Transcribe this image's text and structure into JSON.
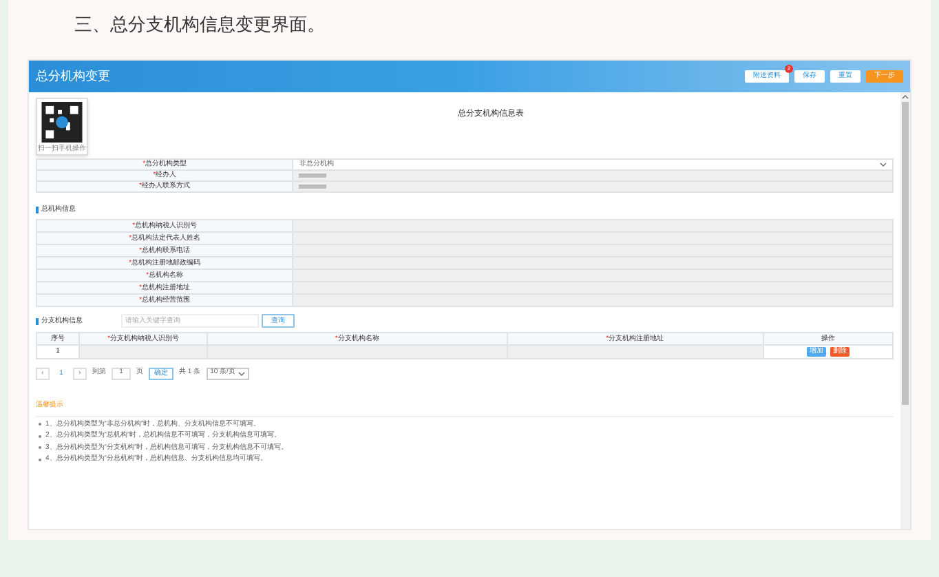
{
  "doc_heading": "三、总分支机构信息变更界面。",
  "window": {
    "title": "总分机构变更",
    "buttons": [
      {
        "label": "附送资料",
        "badge": "2",
        "kind": "plain"
      },
      {
        "label": "保存",
        "kind": "plain"
      },
      {
        "label": "重置",
        "kind": "plain"
      },
      {
        "label": "下一步",
        "kind": "primary"
      }
    ]
  },
  "qr_caption": "扫一扫手机操作",
  "required_mark": "*",
  "form_title": "总分支机构信息表",
  "basic_fields": [
    {
      "label": "总分机构类型",
      "required": true,
      "kind": "select",
      "value": "非总分机构"
    },
    {
      "label": "经办人",
      "required": true,
      "kind": "masked"
    },
    {
      "label": "经办人联系方式",
      "required": true,
      "kind": "masked"
    }
  ],
  "head_section": {
    "title": "总机构信息",
    "fields": [
      {
        "label": "总机构纳税人识别号",
        "required": true
      },
      {
        "label": "总机构法定代表人姓名",
        "required": true
      },
      {
        "label": "总机构联系电话",
        "required": true
      },
      {
        "label": "总机构注册地邮政编码",
        "required": true
      },
      {
        "label": "总机构名称",
        "required": true
      },
      {
        "label": "总机构注册地址",
        "required": true
      },
      {
        "label": "总机构经营范围",
        "required": true
      }
    ]
  },
  "branch_section": {
    "title": "分支机构信息",
    "search": {
      "placeholder": "请输入关键字查询"
    },
    "search_button": "查询",
    "columns": [
      {
        "label": "序号",
        "required": false
      },
      {
        "label": "分支机构纳税人识别号",
        "required": true
      },
      {
        "label": "分支机构名称",
        "required": true
      },
      {
        "label": "分支机构注册地址",
        "required": true
      },
      {
        "label": "操作",
        "required": false
      }
    ],
    "rows": [
      {
        "index": "1",
        "actions": [
          {
            "label": "增加",
            "kind": "add"
          },
          {
            "label": "删除",
            "kind": "delete"
          }
        ]
      }
    ],
    "pagination": {
      "prev": "‹",
      "pages": [
        {
          "label": "1",
          "selected": true
        }
      ],
      "next": "›",
      "goto_label": "到第",
      "goto_value": "1",
      "page_unit": "页",
      "confirm": "确定",
      "total": "共 1 条",
      "page_size": "10 条/页"
    }
  },
  "tips": {
    "title": "温馨提示",
    "items": [
      "1、总分机构类型为“非总分机构”时，总机构、分支机构信息不可填写。",
      "2、总分机构类型为“总机构”时，总机构信息不可填写，分支机构信息可填写。",
      "3、总分机构类型为“分支机构”时，总机构信息可填写，分支机构信息不可填写。",
      "4、总分机构类型为“分总机构”时，总机构信息、分支机构信息均可填写。"
    ]
  }
}
